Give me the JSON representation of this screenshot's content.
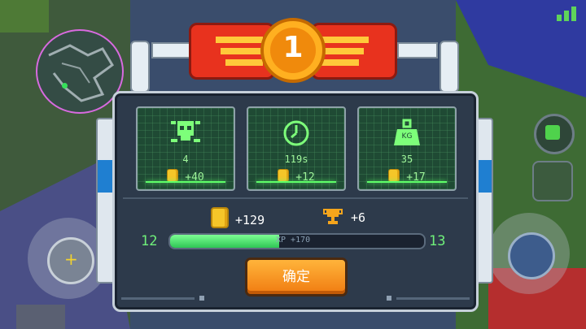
{
  "header": {
    "rank": "1"
  },
  "stats": [
    {
      "icon": "skull-icon",
      "value": "4",
      "bonus": "+40"
    },
    {
      "icon": "clock-icon",
      "value": "119s",
      "bonus": "+12"
    },
    {
      "icon": "weight-icon",
      "value": "35",
      "bonus": "+17",
      "icon_label": "KG"
    }
  ],
  "rewards": {
    "coins": "+129",
    "trophies": "+6"
  },
  "level": {
    "current": "12",
    "next": "13",
    "xp_label": "XP +170",
    "progress": 0.43
  },
  "buttons": {
    "confirm": "确定"
  },
  "colors": {
    "accent_green": "#6ff07a",
    "button_orange": "#f89a24",
    "banner_red": "#e8321e"
  }
}
